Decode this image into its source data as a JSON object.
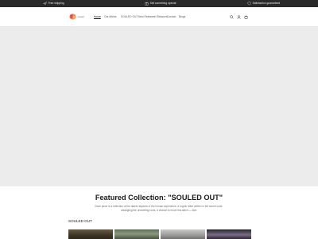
{
  "announcements": [
    {
      "icon": "airplane-icon",
      "text": "Free shipping"
    },
    {
      "icon": "gift-icon",
      "text": "Sell something special"
    },
    {
      "icon": "shield-icon",
      "text": "Satisfaction guaranteed"
    }
  ],
  "header": {
    "logo_text": "souled",
    "nav": [
      "Home",
      "Our Artists",
      "SOULED OUT",
      "New Releases/ Reissues",
      "Contact",
      "Blogs"
    ],
    "active_index": 0,
    "icons": [
      "search-icon",
      "account-icon",
      "cart-icon"
    ]
  },
  "featured": {
    "title": "Featured Collection: \"SOULED OUT\"",
    "description": "Each piece is a reflection of the darker aspects of the human experience, a cryptic letter written in the secret code, untangling the unraveling roots, a chance to move this stitch — dive.",
    "collection_label": "SOULED OUT"
  },
  "colors": {
    "announcement_bg": "#2a2a2a",
    "hero_placeholder": "#ececec",
    "text": "#121212"
  }
}
